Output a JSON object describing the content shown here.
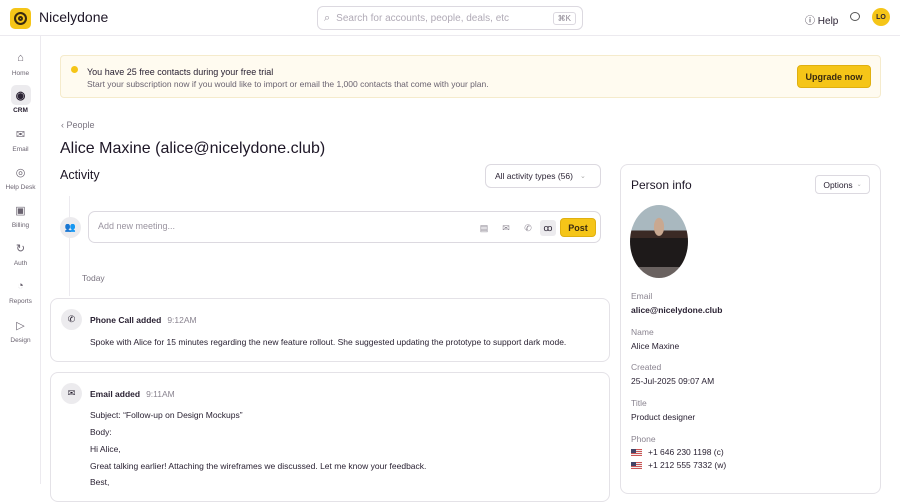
{
  "app": {
    "name": "Nicelydone"
  },
  "search": {
    "placeholder": "Search for accounts, people, deals, etc",
    "shortcut": "⌘K"
  },
  "header": {
    "help": "Help",
    "avatar_initials": "LO"
  },
  "sidebar": {
    "items": [
      {
        "label": "Home"
      },
      {
        "label": "CRM"
      },
      {
        "label": "Email"
      },
      {
        "label": "Help Desk"
      },
      {
        "label": "Billing"
      },
      {
        "label": "Auth"
      },
      {
        "label": "Reports"
      },
      {
        "label": "Design"
      }
    ]
  },
  "banner": {
    "title": "You have 25 free contacts during your free trial",
    "text": "Start your subscription now if you would like to import or email the 1,000 contacts that come with your plan.",
    "button": "Upgrade now"
  },
  "breadcrumb": "People",
  "page_title": "Alice Maxine (alice@nicelydone.club)",
  "activity": {
    "title": "Activity",
    "filter": "All activity types (56)",
    "composer_placeholder": "Add new meeting...",
    "post": "Post",
    "group_label": "Today",
    "items": [
      {
        "title": "Phone Call added",
        "time": "9:12AM",
        "body": "Spoke with Alice for 15 minutes regarding the new feature rollout. She suggested updating the prototype to support dark mode."
      },
      {
        "title": "Email added",
        "time": "9:11AM",
        "subject": "Subject: “Follow-up on Design Mockups”",
        "body_label": "Body:",
        "greeting": "Hi Alice,",
        "message": "Great talking earlier! Attaching the wireframes we discussed. Let me know your feedback.",
        "signoff": "Best,"
      }
    ]
  },
  "person": {
    "title": "Person info",
    "options": "Options",
    "fields": [
      {
        "label": "Email",
        "value": "alice@nicelydone.club"
      },
      {
        "label": "Name",
        "value": "Alice Maxine"
      },
      {
        "label": "Created",
        "value": "25-Jul-2025 09:07 AM"
      },
      {
        "label": "Title",
        "value": "Product designer"
      }
    ],
    "phone_label": "Phone",
    "phones": [
      "+1 646 230 1198 (c)",
      "+1 212 555 7332 (w)"
    ]
  },
  "colors": {
    "accent": "#f5c518"
  }
}
